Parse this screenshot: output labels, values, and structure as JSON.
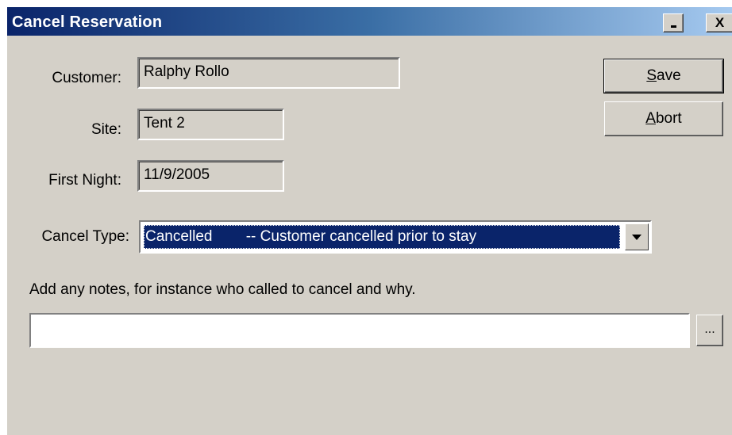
{
  "window": {
    "title": "Cancel Reservation",
    "minimize_glyph": "_",
    "close_glyph": "X"
  },
  "form": {
    "customer_label": "Customer:",
    "customer_value": "Ralphy Rollo",
    "site_label": "Site:",
    "site_value": "Tent 2",
    "first_night_label": "First Night:",
    "first_night_value": "11/9/2005",
    "cancel_type_label": "Cancel Type:",
    "cancel_type_selected": "Cancelled        -- Customer cancelled prior to stay",
    "notes_hint": "Add any notes, for instance who called to cancel and why.",
    "notes_value": "",
    "notes_browse_label": "..."
  },
  "buttons": {
    "save_access": "S",
    "save_rest": "ave",
    "abort_access": "A",
    "abort_rest": "bort"
  },
  "colors": {
    "face": "#d4d0c8",
    "title_start": "#0a246a",
    "title_end": "#a6caf0",
    "selection": "#0a246a"
  },
  "icons": [
    "minimize-icon",
    "close-icon",
    "dropdown-arrow-icon"
  ]
}
